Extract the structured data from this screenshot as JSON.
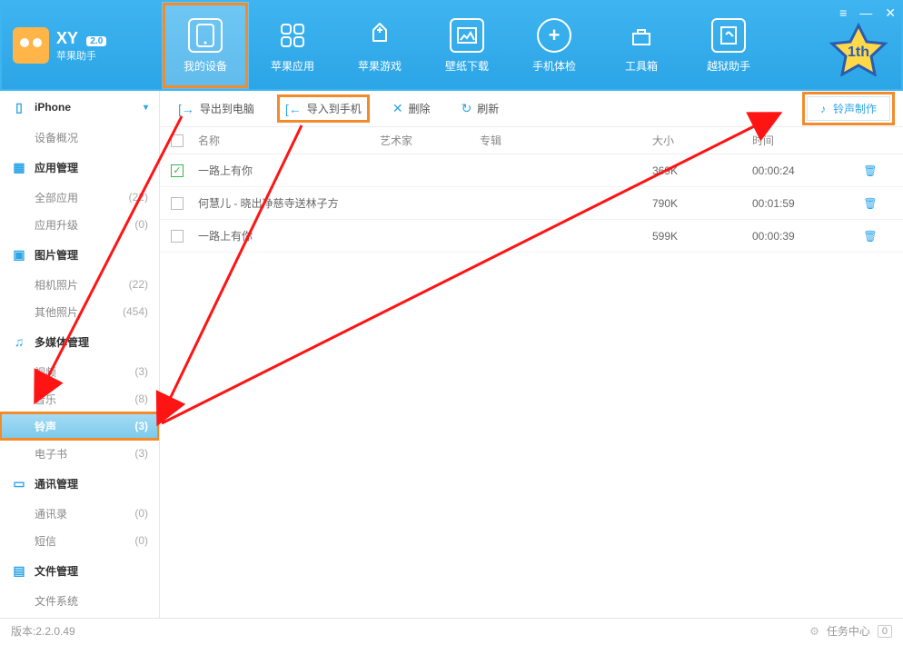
{
  "brand": {
    "title": "XY",
    "version": "2.0",
    "subtitle": "苹果助手"
  },
  "window_controls": {
    "settings": "≡",
    "min": "—",
    "close": "✕"
  },
  "nav": [
    {
      "label": "我的设备",
      "active": true,
      "icon": "device"
    },
    {
      "label": "苹果应用",
      "active": false,
      "icon": "apps"
    },
    {
      "label": "苹果游戏",
      "active": false,
      "icon": "game"
    },
    {
      "label": "壁纸下载",
      "active": false,
      "icon": "wallpaper"
    },
    {
      "label": "手机体检",
      "active": false,
      "icon": "health"
    },
    {
      "label": "工具箱",
      "active": false,
      "icon": "toolbox"
    },
    {
      "label": "越狱助手",
      "active": false,
      "icon": "jailbreak"
    }
  ],
  "promo_badge": "1th",
  "sidebar": {
    "device": {
      "name": "iPhone",
      "overview": "设备概况"
    },
    "sections": [
      {
        "title": "应用管理",
        "icon": "apps-icon",
        "items": [
          {
            "label": "全部应用",
            "count": "(22)"
          },
          {
            "label": "应用升级",
            "count": "(0)"
          }
        ]
      },
      {
        "title": "图片管理",
        "icon": "photo-icon",
        "items": [
          {
            "label": "相机照片",
            "count": "(22)"
          },
          {
            "label": "其他照片",
            "count": "(454)"
          }
        ]
      },
      {
        "title": "多媒体管理",
        "icon": "media-icon",
        "items": [
          {
            "label": "视频",
            "count": "(3)"
          },
          {
            "label": "音乐",
            "count": "(8)"
          },
          {
            "label": "铃声",
            "count": "(3)",
            "active": true
          },
          {
            "label": "电子书",
            "count": "(3)"
          }
        ]
      },
      {
        "title": "通讯管理",
        "icon": "comm-icon",
        "items": [
          {
            "label": "通讯录",
            "count": "(0)"
          },
          {
            "label": "短信",
            "count": "(0)"
          }
        ]
      },
      {
        "title": "文件管理",
        "icon": "file-icon",
        "items": [
          {
            "label": "文件系统",
            "count": ""
          }
        ]
      }
    ]
  },
  "toolbar": {
    "export": "导出到电脑",
    "import": "导入到手机",
    "delete": "删除",
    "refresh": "刷新",
    "maker": "铃声制作"
  },
  "table": {
    "headers": {
      "name": "名称",
      "artist": "艺术家",
      "album": "专辑",
      "size": "大小",
      "time": "时间"
    },
    "rows": [
      {
        "checked": true,
        "name": "一路上有你",
        "artist": "",
        "album": "",
        "size": "369K",
        "time": "00:00:24"
      },
      {
        "checked": false,
        "name": "何慧儿 - 晓出净慈寺送林子方",
        "artist": "",
        "album": "",
        "size": "790K",
        "time": "00:01:59"
      },
      {
        "checked": false,
        "name": "一路上有你",
        "artist": "",
        "album": "",
        "size": "599K",
        "time": "00:00:39"
      }
    ]
  },
  "status": {
    "version_label": "版本:2.2.0.49",
    "task_center": "任务中心",
    "task_count": "0"
  }
}
